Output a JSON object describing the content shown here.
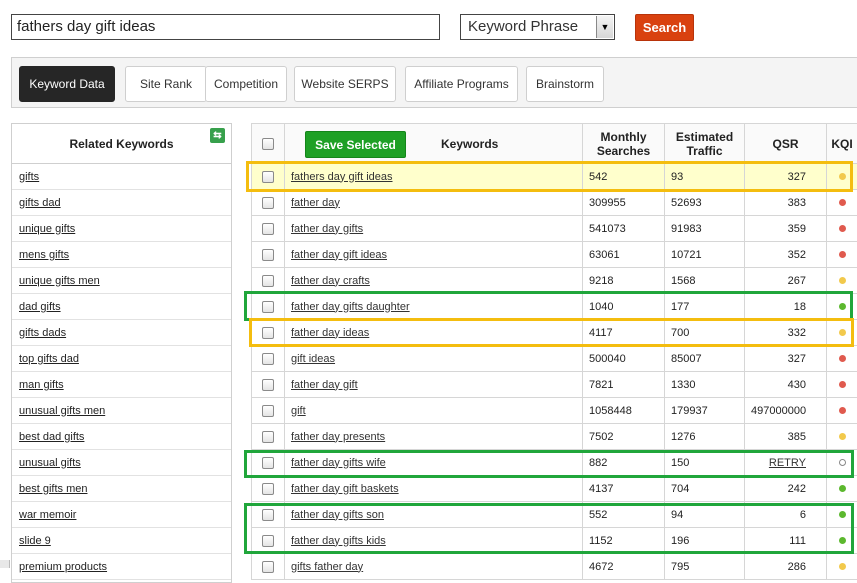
{
  "search": {
    "value": "fathers day gift ideas"
  },
  "match_type": {
    "selected": "Keyword Phrase"
  },
  "search_button_label": "Search",
  "tabs": [
    {
      "label": "Keyword Data",
      "active": true
    },
    {
      "label": "Site Rank"
    },
    {
      "label": "Competition"
    },
    {
      "label": "Website SERPS"
    },
    {
      "label": "Affiliate Programs"
    },
    {
      "label": "Brainstorm"
    }
  ],
  "related": {
    "title": "Related Keywords",
    "items": [
      "gifts",
      "gifts dad",
      "unique gifts",
      "mens gifts",
      "unique gifts men",
      "dad gifts",
      "gifts dads",
      "top gifts dad",
      "man gifts",
      "unusual gifts men",
      "best dad gifts",
      "unusual gifts",
      "best gifts men",
      "war memoir",
      "slide 9",
      "premium products"
    ]
  },
  "table": {
    "save_label": "Save Selected",
    "columns": {
      "keywords": "Keywords",
      "monthly": "Monthly Searches",
      "traffic": "Estimated Traffic",
      "qsr": "QSR",
      "kqi": "KQI"
    },
    "rows": [
      {
        "keyword": "fathers day gift ideas",
        "monthly": "542",
        "traffic": "93",
        "qsr": "327",
        "kqi": "yellow"
      },
      {
        "keyword": "father day",
        "monthly": "309955",
        "traffic": "52693",
        "qsr": "383",
        "kqi": "red"
      },
      {
        "keyword": "father day gifts",
        "monthly": "541073",
        "traffic": "91983",
        "qsr": "359",
        "kqi": "red"
      },
      {
        "keyword": "father day gift ideas",
        "monthly": "63061",
        "traffic": "10721",
        "qsr": "352",
        "kqi": "red"
      },
      {
        "keyword": "father day crafts",
        "monthly": "9218",
        "traffic": "1568",
        "qsr": "267",
        "kqi": "yellow"
      },
      {
        "keyword": "father day gifts daughter",
        "monthly": "1040",
        "traffic": "177",
        "qsr": "18",
        "kqi": "green"
      },
      {
        "keyword": "father day ideas",
        "monthly": "4117",
        "traffic": "700",
        "qsr": "332",
        "kqi": "yellow"
      },
      {
        "keyword": "gift ideas",
        "monthly": "500040",
        "traffic": "85007",
        "qsr": "327",
        "kqi": "red"
      },
      {
        "keyword": "father day gift",
        "monthly": "7821",
        "traffic": "1330",
        "qsr": "430",
        "kqi": "red"
      },
      {
        "keyword": "gift",
        "monthly": "1058448",
        "traffic": "179937",
        "qsr": "497000000",
        "kqi": "red"
      },
      {
        "keyword": "father day presents",
        "monthly": "7502",
        "traffic": "1276",
        "qsr": "385",
        "kqi": "yellow"
      },
      {
        "keyword": "father day gifts wife",
        "monthly": "882",
        "traffic": "150",
        "qsr": "RETRY",
        "kqi": "none"
      },
      {
        "keyword": "father day gift baskets",
        "monthly": "4137",
        "traffic": "704",
        "qsr": "242",
        "kqi": "green"
      },
      {
        "keyword": "father day gifts son",
        "monthly": "552",
        "traffic": "94",
        "qsr": "6",
        "kqi": "green"
      },
      {
        "keyword": "father day gifts kids",
        "monthly": "1152",
        "traffic": "196",
        "qsr": "111",
        "kqi": "green"
      },
      {
        "keyword": "gifts father day",
        "monthly": "4672",
        "traffic": "795",
        "qsr": "286",
        "kqi": "yellow"
      }
    ]
  },
  "colors": {
    "red": "#e05a4e",
    "yellow": "#f2c94c",
    "green": "#5cb82e",
    "accent_search": "#d9410f",
    "accent_save": "#1ea025"
  }
}
